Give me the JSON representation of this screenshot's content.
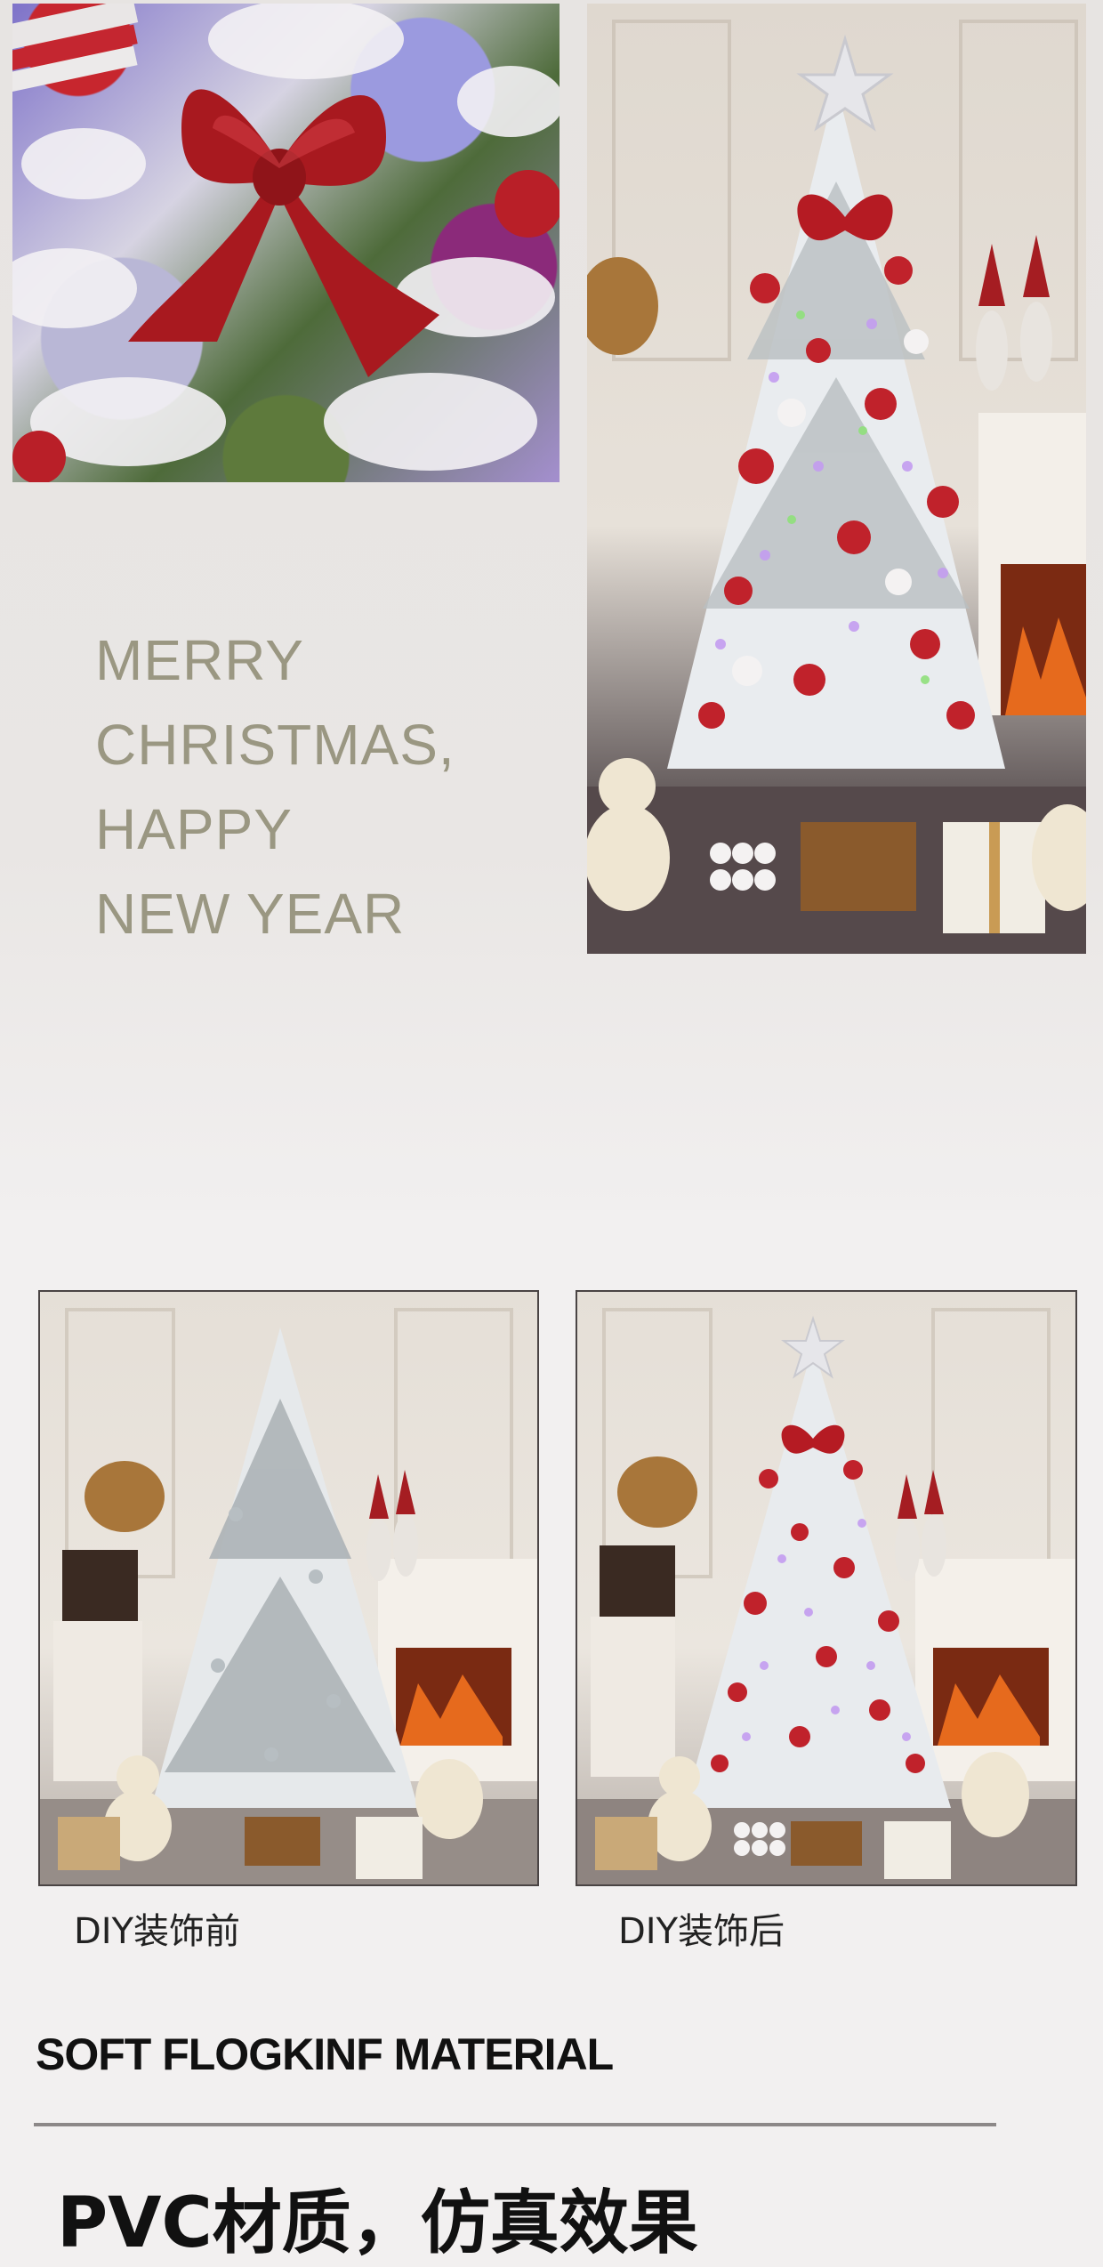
{
  "greeting": {
    "line1": "MERRY",
    "line2": "CHRISTMAS,",
    "line3": "HAPPY",
    "line4": "NEW YEAR"
  },
  "comparison": {
    "before_caption": "DIY装饰前",
    "after_caption": "DIY装饰后"
  },
  "material": {
    "title": "SOFT FLOGKINF MATERIAL",
    "subtitle": "PVC材质，仿真效果"
  },
  "colors": {
    "greeting_text": "#9a9782",
    "ornament_red": "#c0222b",
    "bow_red": "#a8191f",
    "divider": "#8c8888"
  },
  "images": {
    "top_left": "red-glitter-bow-closeup",
    "top_right": "decorated-flocked-christmas-tree",
    "before": "undecorated-flocked-tree",
    "after": "decorated-flocked-tree"
  }
}
